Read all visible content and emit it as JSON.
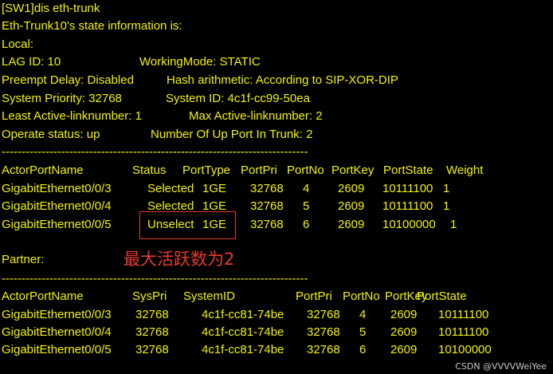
{
  "lines": [
    "[SW1]dis eth-trunk",
    "Eth-Trunk10's state information is:",
    "Local:"
  ],
  "local": {
    "lag_id": "LAG ID: 10",
    "working_mode": "WorkingMode: STATIC",
    "preempt_delay": "Preempt Delay: Disabled",
    "hash": "Hash arithmetic: According to SIP-XOR-DIP",
    "system_priority": "System Priority: 32768",
    "system_id": "System ID: 4c1f-cc99-50ea",
    "least_active": "Least Active-linknumber: 1",
    "max_active": "Max Active-linknumber: 2",
    "operate_status": "Operate status: up",
    "up_ports": "Number Of Up Port In Trunk: 2",
    "separator": "-----------------------------------------------------------------------------",
    "headers": [
      "ActorPortName",
      "Status",
      "PortType",
      "PortPri",
      "PortNo",
      "PortKey",
      "PortState",
      "Weight"
    ],
    "rows": [
      [
        "GigabitEthernet0/0/3",
        "Selected",
        "1GE",
        "32768",
        "4",
        "2609",
        "10111100",
        "1"
      ],
      [
        "GigabitEthernet0/0/4",
        "Selected",
        "1GE",
        "32768",
        "5",
        "2609",
        "10111100",
        "1"
      ],
      [
        "GigabitEthernet0/0/5",
        "Unselect",
        "1GE",
        "32768",
        "6",
        "2609",
        "10100000",
        "1"
      ]
    ]
  },
  "partner": {
    "label": "Partner:",
    "separator": "-----------------------------------------------------------------------------",
    "headers": [
      "ActorPortName",
      "SysPri",
      "SystemID",
      "PortPri",
      "PortNo",
      "PortKey",
      "PortState"
    ],
    "rows": [
      [
        "GigabitEthernet0/0/3",
        "32768",
        "4c1f-cc81-74be",
        "32768",
        "4",
        "2609",
        "10111100"
      ],
      [
        "GigabitEthernet0/0/4",
        "32768",
        "4c1f-cc81-74be",
        "32768",
        "5",
        "2609",
        "10111100"
      ],
      [
        "GigabitEthernet0/0/5",
        "32768",
        "4c1f-cc81-74be",
        "32768",
        "6",
        "2609",
        "10100000"
      ]
    ]
  },
  "annotation": "最大活跃数为2",
  "watermark": "CSDN @VVVVWeiYee",
  "colors": {
    "background": "#000000",
    "text": "#f3f300",
    "annotation": "#e63a2c"
  }
}
